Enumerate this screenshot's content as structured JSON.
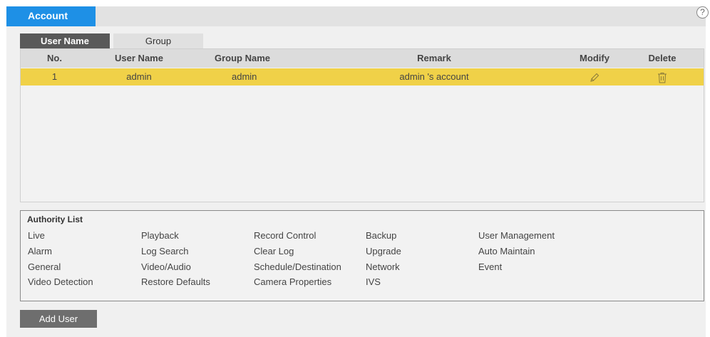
{
  "header": {
    "tab_label": "Account",
    "help_glyph": "?"
  },
  "subtabs": [
    {
      "label": "User Name",
      "active": true
    },
    {
      "label": "Group",
      "active": false
    }
  ],
  "table": {
    "columns": [
      "No.",
      "User Name",
      "Group Name",
      "Remark",
      "Modify",
      "Delete"
    ],
    "rows": [
      {
        "no": "1",
        "user_name": "admin",
        "group_name": "admin",
        "remark": "admin 's account",
        "modify_icon": "pencil-icon",
        "delete_icon": "trash-icon"
      }
    ]
  },
  "authority": {
    "title": "Authority List",
    "columns": [
      [
        "Live",
        "Alarm",
        "General",
        "Video Detection"
      ],
      [
        "Playback",
        "Log Search",
        "Video/Audio",
        "Restore Defaults"
      ],
      [
        "Record Control",
        "Clear Log",
        "Schedule/Destination",
        "Camera Properties"
      ],
      [
        "Backup",
        "Upgrade",
        "Network",
        "IVS"
      ],
      [
        "User Management",
        "Auto Maintain",
        "Event"
      ]
    ]
  },
  "actions": {
    "add_user_label": "Add User"
  },
  "colors": {
    "accent": "#1e90e6",
    "selected_row": "#f0d148",
    "active_subtab": "#595959"
  }
}
